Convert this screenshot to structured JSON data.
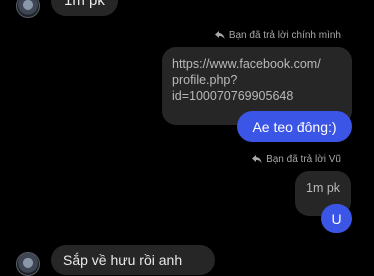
{
  "messages": {
    "top_incoming_text": "1m pk",
    "reply_note_1": "Bạn đã trả lời chính mình",
    "link_text": "https://www.facebook.com/\nprofile.php?\nid=100070769905648",
    "outgoing_1": "Ae teo đông:)",
    "reply_note_2": "Bạn đã trả lời Vũ",
    "quoted_text": "1m pk",
    "outgoing_2": "U",
    "bottom_incoming_partial": "Sắp về hưu rồi anh"
  },
  "colors": {
    "background": "#000000",
    "incoming_bubble": "#262626",
    "outgoing_bubble": "#3b55e6",
    "meta_text": "#a8a8a8"
  }
}
